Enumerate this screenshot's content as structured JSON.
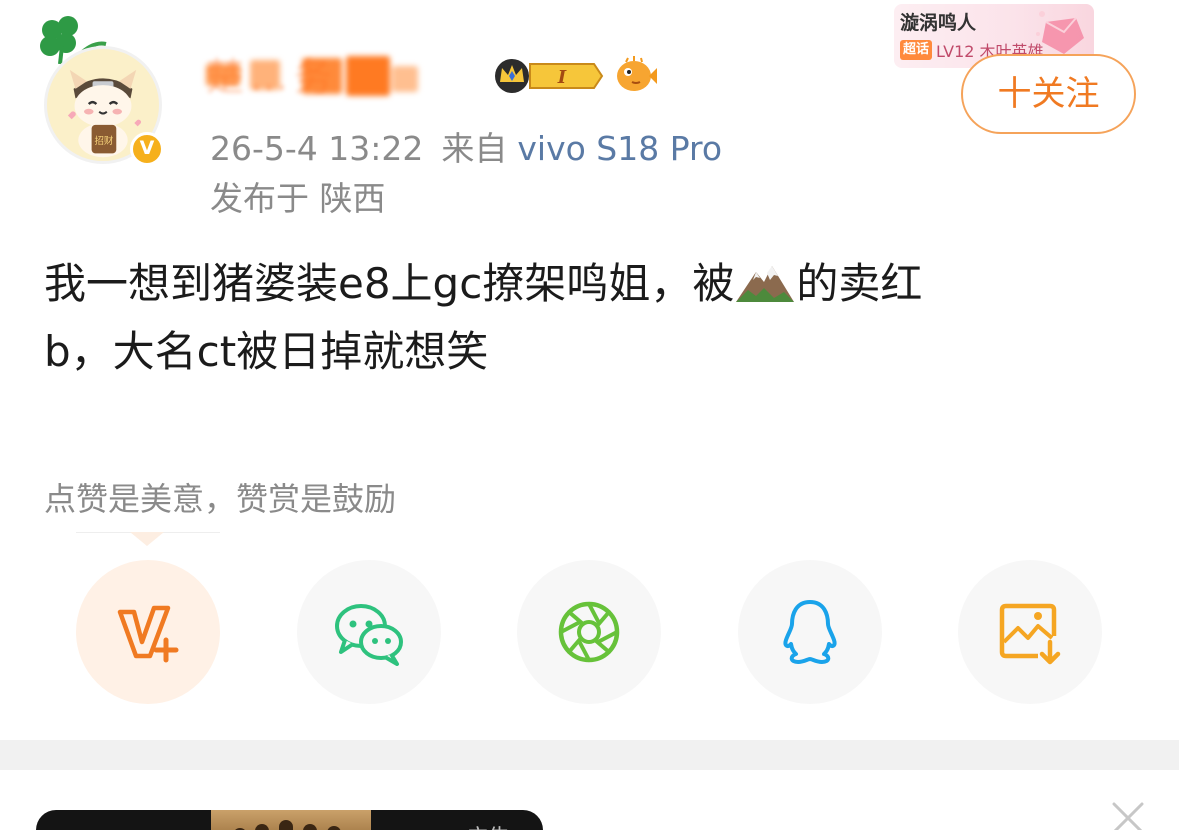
{
  "user": {
    "name_obscured": "楚…务",
    "avatar_icon": "cat-avatar-icon",
    "verified_badge": "V",
    "level_badge": "I"
  },
  "post_meta": {
    "time": "26-5-4 13:22",
    "source_prefix": "来自",
    "device": "vivo S18 Pro",
    "location": "发布于 陕西"
  },
  "supertopic": {
    "name": "漩涡鸣人",
    "tag": "超话",
    "level": "LV12 木叶英雄"
  },
  "follow": {
    "label": "十关注"
  },
  "post": {
    "line1_before_emoji": "我一想到猪婆装e8上gc撩架鸣姐，被",
    "emoji": "mountain-emoji",
    "line1_after_emoji": "的卖红",
    "line2": "b，大名ct被日掉就想笑"
  },
  "reward_hint": "点赞是美意，赞赏是鼓励",
  "share": [
    {
      "id": "reward",
      "icon": "v-plus-icon",
      "color": "#f07a22"
    },
    {
      "id": "wechat",
      "icon": "wechat-icon",
      "color": "#2ec27e"
    },
    {
      "id": "moments",
      "icon": "moments-icon",
      "color": "#67c23a"
    },
    {
      "id": "qq",
      "icon": "qq-icon",
      "color": "#1aa3ea"
    },
    {
      "id": "save-image",
      "icon": "save-image-icon",
      "color": "#f5a623"
    }
  ],
  "ad": {
    "label": "广告"
  }
}
